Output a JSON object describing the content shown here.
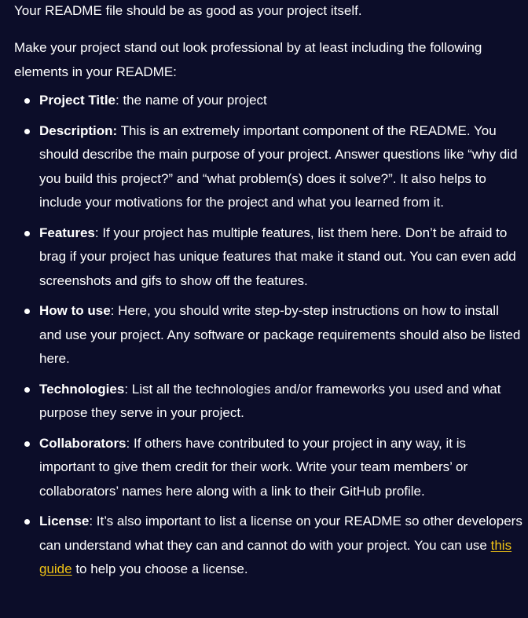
{
  "intro": "Your README file should be as good as your project itself.",
  "lead": "Make your project stand out look professional by at least including the following elements in your README:",
  "items": [
    {
      "term": "Project Title",
      "sep": ":",
      "text": " the name of your project"
    },
    {
      "term": "Description:",
      "sep": "",
      "text": " This is an extremely important component of the README. You should describe the main purpose of your project. Answer questions like “why did you build this project?” and “what problem(s) does it solve?”. It also helps to include your motivations for the project and what you learned from it."
    },
    {
      "term": "Features",
      "sep": ":",
      "text": " If your project has multiple features, list them here. Don’t be afraid to brag if your project has unique features that make it stand out. You can even add screenshots and gifs to show off the features."
    },
    {
      "term": "How to use",
      "sep": ":",
      "text": " Here, you should write step-by-step instructions on how to install and use your project. Any software or package requirements should also be listed here."
    },
    {
      "term": "Technologies",
      "sep": ":",
      "text": " List all the technologies and/or frameworks you used and what purpose they serve in your project."
    },
    {
      "term": "Collaborators",
      "sep": ":",
      "text": " If others have contributed to your project in any way, it is important to give them credit for their work. Write your team members’ or collaborators’ names here along with a link to their GitHub profile."
    },
    {
      "term": "License",
      "sep": ":",
      "text": " It’s also important to list a license on your README so other developers can understand what they can and cannot do with your project. You can use ",
      "link": "this guide",
      "after": " to help you choose a license."
    }
  ]
}
